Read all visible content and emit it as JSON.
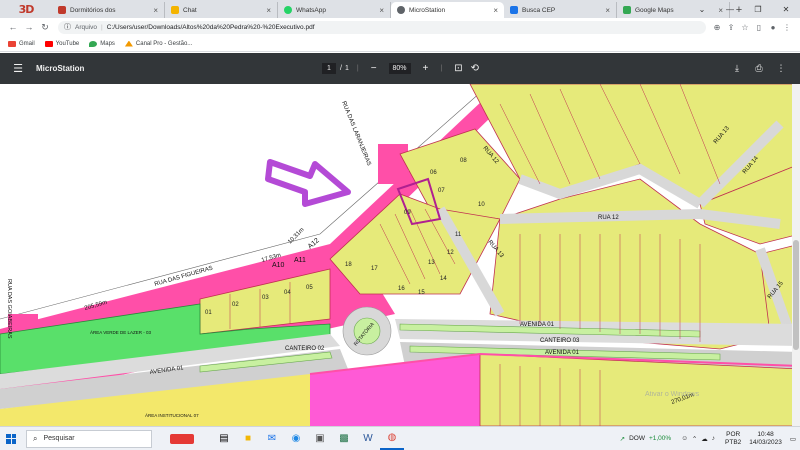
{
  "browser": {
    "brand_mark": "3D",
    "tabs": [
      {
        "title": "Dormitórios dos",
        "favicon_color": "#c0392b"
      },
      {
        "title": "Chat",
        "favicon_color": "#f4b400"
      },
      {
        "title": "WhatsApp",
        "favicon_color": "#25d366"
      },
      {
        "title": "MicroStation",
        "favicon_color": "#5f6368",
        "active": true
      },
      {
        "title": "Busca CEP",
        "favicon_color": "#1a73e8"
      },
      {
        "title": "Google Maps",
        "favicon_color": "#34a853"
      }
    ],
    "address": {
      "site_label": "Arquivo",
      "url": "C:/Users/user/Downloads/Altos%20da%20Pedra%20-%20Executivo.pdf"
    },
    "bookmarks": [
      {
        "label": "Gmail",
        "color": "#ea4335"
      },
      {
        "label": "YouTube",
        "color": "#ff0000"
      },
      {
        "label": "Maps",
        "color": "#34a853"
      },
      {
        "label": "Canal Pro - Gestão...",
        "color": "#f29900"
      }
    ]
  },
  "pdf": {
    "title": "MicroStation",
    "page_current": "1",
    "page_sep": "/",
    "page_total": "1",
    "zoom": "80%"
  },
  "map": {
    "streets": {
      "laranjeiras": "RUA DAS LARANJEIRAS",
      "figueiras": "RUA DAS FIGUEIRAS",
      "goiabeiras": "RUA DAS GOIABEIRAS",
      "rua12": "RUA 12",
      "rua13": "RUA 13",
      "rua14": "RUA 14",
      "rua15": "RUA 15",
      "avenida01": "AVENIDA 01",
      "canteiro02": "CANTEIRO 02",
      "canteiro03": "CANTEIRO 03",
      "rotatoria": "ROTATÓRIA"
    },
    "annotations": {
      "dim_205": "205,59m",
      "dim_1753": "17,53m",
      "dim_1031": "10,31m",
      "dim_270": "270,01m",
      "a10": "A10",
      "a11": "A11",
      "a12": "A12",
      "area_lazer": "ÁREA VERDE DE LAZER - 03",
      "area_inst": "ÁREA INSTITUCIONAL 07"
    },
    "watermark": "Ativar o Windows",
    "lot_numbers": [
      "01",
      "02",
      "03",
      "04",
      "05",
      "06",
      "07",
      "08",
      "09",
      "10",
      "11",
      "12",
      "13",
      "14",
      "15",
      "16",
      "17",
      "18"
    ]
  },
  "taskbar": {
    "search_placeholder": "Pesquisar",
    "ticker_name": "DOW",
    "ticker_value": "+1,00%",
    "lang": "POR",
    "layout": "PTB2",
    "time": "10:48",
    "date": "14/03/2023"
  },
  "colors": {
    "road_pink": "#ff4fa8",
    "lot_yellow": "#e6ea7a",
    "green": "#59e06a",
    "magenta": "#ff5ad6",
    "arrow": "#b44ad6",
    "bar_dark": "#323639"
  }
}
